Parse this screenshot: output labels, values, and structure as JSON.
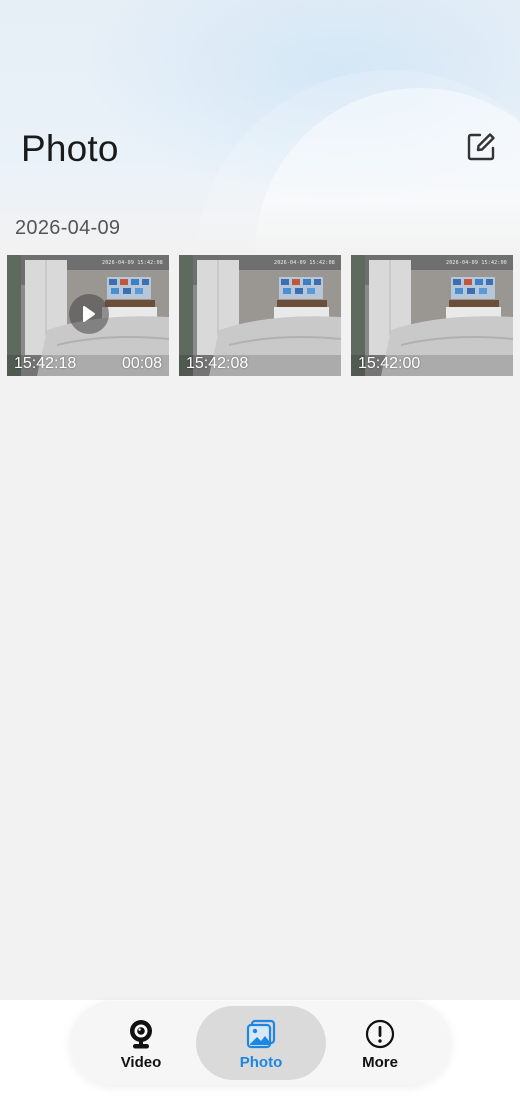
{
  "header": {
    "title": "Photo",
    "edit_icon": "edit-icon"
  },
  "section": {
    "date": "2026-04-09"
  },
  "media": [
    {
      "time": "15:42:18",
      "duration": "00:08",
      "type": "video",
      "overlay_stamp": "2026-04-09 15:42:08"
    },
    {
      "time": "15:42:08",
      "duration": "",
      "type": "photo",
      "overlay_stamp": "2026-04-09 15:42:08"
    },
    {
      "time": "15:42:00",
      "duration": "",
      "type": "photo",
      "overlay_stamp": "2026-04-09 15:42:00"
    }
  ],
  "tabs": [
    {
      "label": "Video",
      "icon": "webcam-icon",
      "active": false
    },
    {
      "label": "Photo",
      "icon": "image-icon",
      "active": true
    },
    {
      "label": "More",
      "icon": "exclamation-circle-icon",
      "active": false
    }
  ],
  "colors": {
    "accent": "#1d86e3",
    "background": "#f2f2f2",
    "text_primary": "#1a1a1a"
  }
}
